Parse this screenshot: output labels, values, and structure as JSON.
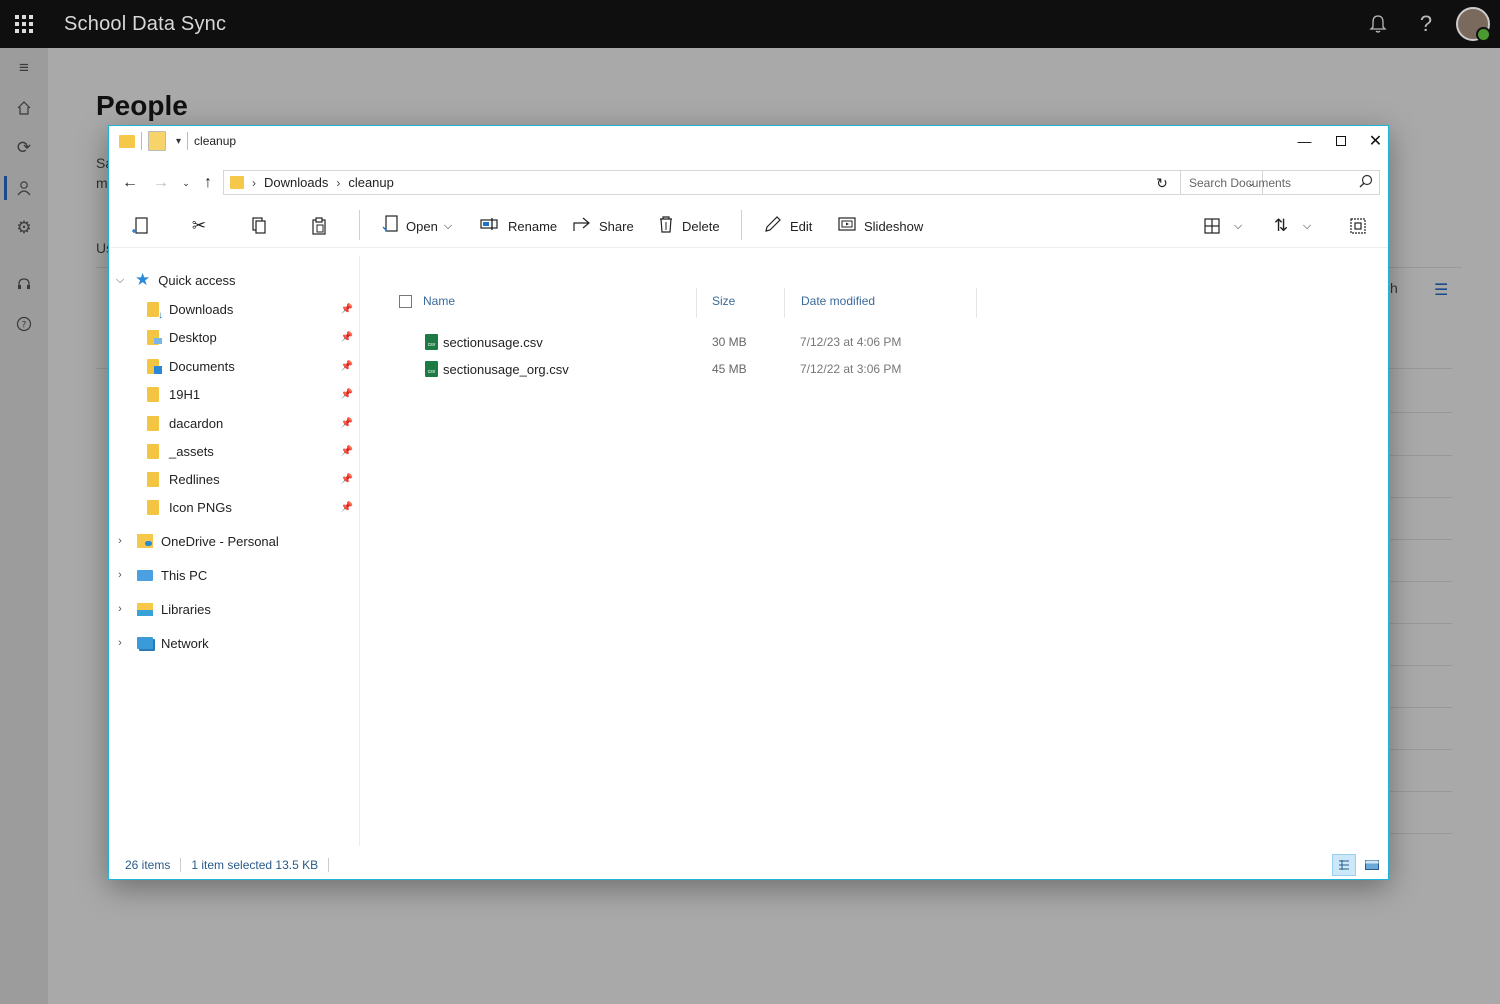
{
  "app": {
    "title": "School Data Sync"
  },
  "page": {
    "heading": "People",
    "frag1": "Sa",
    "frag2": "m",
    "frag3": "Us",
    "frag4": "h"
  },
  "explorer": {
    "title": "cleanup",
    "breadcrumb": [
      "Downloads",
      "cleanup"
    ],
    "search_placeholder": "Search Documents",
    "commands": {
      "open": "Open",
      "rename": "Rename",
      "share": "Share",
      "delete": "Delete",
      "edit": "Edit",
      "slideshow": "Slideshow"
    },
    "nav": {
      "quick_access": "Quick access",
      "pinned": [
        "Downloads",
        "Desktop",
        "Documents",
        "19H1",
        "dacardon",
        "_assets",
        "Redlines",
        "Icon PNGs"
      ],
      "onedrive": "OneDrive - Personal",
      "this_pc": "This PC",
      "libraries": "Libraries",
      "network": "Network"
    },
    "columns": {
      "name": "Name",
      "size": "Size",
      "date": "Date modified"
    },
    "files": [
      {
        "name": "sectionusage.csv",
        "size": "30 MB",
        "date": "7/12/23 at 4:06 PM",
        "type": "csv"
      },
      {
        "name": "sectionusage_org.csv",
        "size": "45 MB",
        "date": "7/12/22 at 3:06 PM",
        "type": "csv"
      }
    ],
    "status": {
      "items": "26 items",
      "selection": "1 item selected 13.5 KB"
    }
  },
  "colors": {
    "accent": "#22b4d8",
    "topbar": "#0f0f0f",
    "csv_icon": "#1e7a45",
    "folder": "#f4c542"
  },
  "icons": {
    "waffle": "waffle-icon",
    "bell": "bell-icon",
    "help": "help-icon",
    "rail": [
      "menu-icon",
      "home-icon",
      "sync-icon",
      "person-icon",
      "settings-icon",
      "headset-icon",
      "help-circle-icon"
    ]
  }
}
